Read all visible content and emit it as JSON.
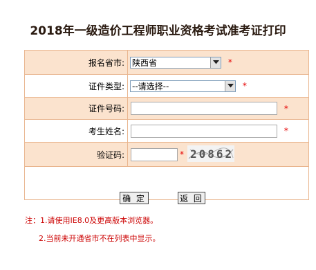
{
  "page": {
    "title": "2018年一级造价工程师职业资格考试准考证打印"
  },
  "form": {
    "province": {
      "label": "报名省市:",
      "value": "陕西省",
      "required_mark": "*"
    },
    "cert_type": {
      "label": "证件类型:",
      "value": "--请选择--",
      "required_mark": "*"
    },
    "cert_number": {
      "label": "证件号码:",
      "value": "",
      "required_mark": "*"
    },
    "name": {
      "label": "考生姓名:",
      "value": "",
      "required_mark": "*"
    },
    "captcha": {
      "label": "验证码:",
      "value": "",
      "required_mark": "*",
      "image_text": "20862"
    }
  },
  "buttons": {
    "confirm": "确 定",
    "back": "返 回"
  },
  "notes": {
    "line1": "注：1.请使用IE8.0及更高版本浏览器。",
    "line2": "2.当前未开通省市不在列表中显示。"
  },
  "colors": {
    "label_bg": "#fbe3ce",
    "border": "#e9b58e",
    "required": "#e60000",
    "note": "#cc0000"
  }
}
